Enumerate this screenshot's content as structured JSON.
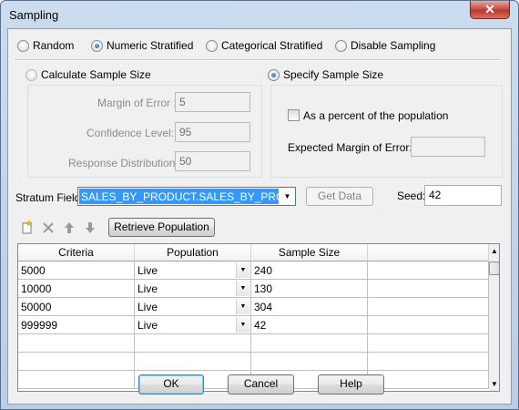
{
  "window": {
    "title": "Sampling",
    "close_glyph": "✕"
  },
  "mode": {
    "options": [
      {
        "label": "Random",
        "checked": false
      },
      {
        "label": "Numeric Stratified",
        "checked": true
      },
      {
        "label": "Categorical Stratified",
        "checked": false
      },
      {
        "label": "Disable Sampling",
        "checked": false
      }
    ]
  },
  "calculate": {
    "label": "Calculate Sample Size",
    "checked": false,
    "margin_of_error_label": "Margin of Error :",
    "margin_of_error_value": "5",
    "confidence_level_label": "Confidence Level:",
    "confidence_level_value": "95",
    "response_distribution_label": "Response Distribution:",
    "response_distribution_value": "50"
  },
  "specify": {
    "label": "Specify Sample Size",
    "checked": true,
    "percent_label": "As a percent of the population",
    "percent_checked": false,
    "expected_margin_label": "Expected Margin of Error:",
    "expected_margin_value": ""
  },
  "stratum": {
    "label": "Stratum Field:",
    "value": "SALES_BY_PRODUCT.SALES_BY_PRODUCT",
    "get_data_label": "Get Data",
    "seed_label": "Seed:",
    "seed_value": "42"
  },
  "toolbar": {
    "icons": [
      "new-row-icon",
      "delete-row-icon",
      "move-up-icon",
      "move-down-icon"
    ],
    "retrieve_label": "Retrieve Population"
  },
  "grid": {
    "columns": [
      "Criteria",
      "Population",
      "Sample Size",
      ""
    ],
    "rows": [
      {
        "criteria": "5000",
        "population": "Live",
        "sample_size": "240"
      },
      {
        "criteria": "10000",
        "population": "Live",
        "sample_size": "130"
      },
      {
        "criteria": "50000",
        "population": "Live",
        "sample_size": "304"
      },
      {
        "criteria": "999999",
        "population": "Live",
        "sample_size": "42"
      }
    ]
  },
  "buttons": {
    "ok": "OK",
    "cancel": "Cancel",
    "help": "Help"
  }
}
